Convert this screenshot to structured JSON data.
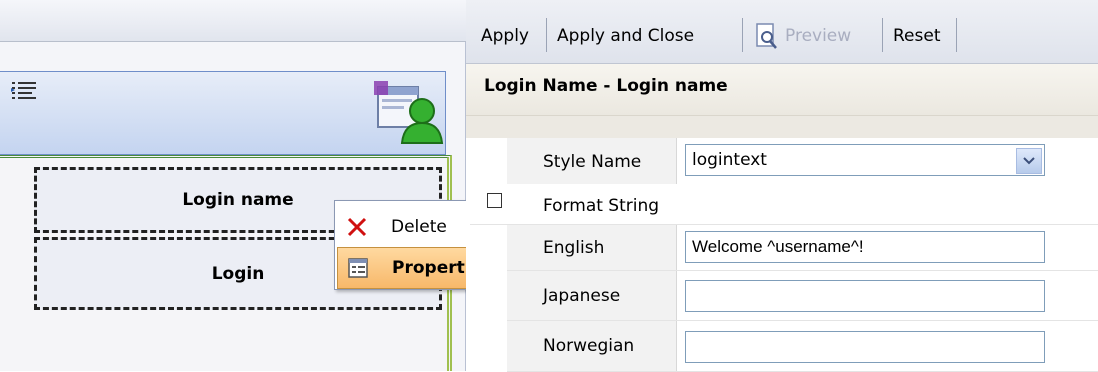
{
  "toolbar": {
    "apply_label": "Apply",
    "apply_close_label": "Apply and Close",
    "preview_label": "Preview",
    "reset_label": "Reset"
  },
  "section": {
    "title": "Login Name - Login name"
  },
  "properties": {
    "style_name": {
      "label": "Style Name",
      "value": "logintext"
    },
    "format_string": {
      "label": "Format String"
    },
    "english": {
      "label": "English",
      "value": "Welcome ^username^!"
    },
    "japanese": {
      "label": "Japanese",
      "value": ""
    },
    "norwegian": {
      "label": "Norwegian",
      "value": ""
    }
  },
  "canvas": {
    "login_name_box": "Login name",
    "login_box": "Login"
  },
  "context_menu": {
    "delete_label": "Delete",
    "properties_label": "Properties"
  },
  "colors": {
    "menu_highlight": "#f7b86a",
    "header_band": "#c4d4f0",
    "delete_icon": "#d01010"
  }
}
